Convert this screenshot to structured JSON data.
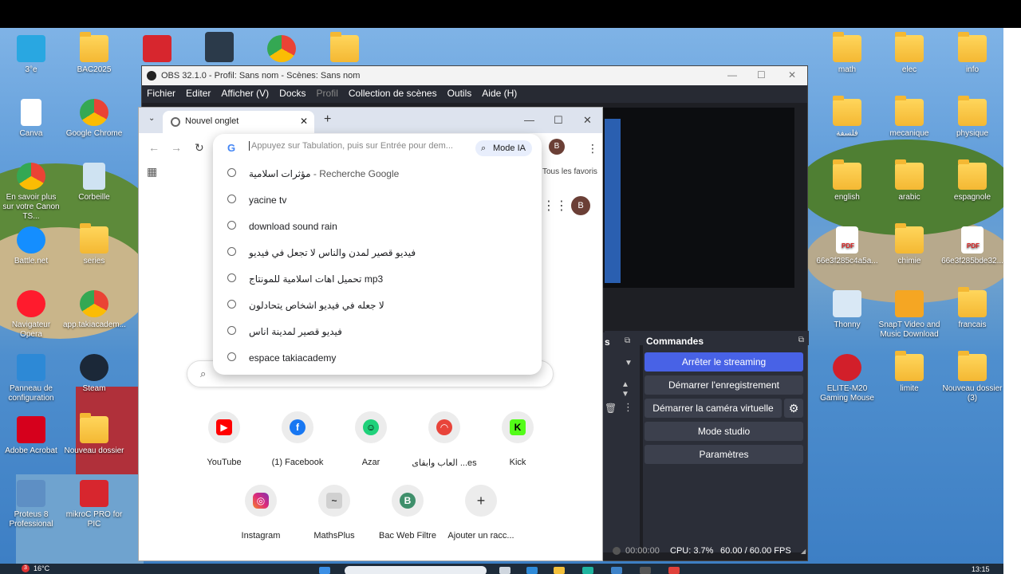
{
  "desktop": {
    "left_icons": [
      {
        "label": "3°e",
        "kind": "monitor"
      },
      {
        "label": "BAC2025",
        "kind": "folder"
      },
      {
        "label": "Canva",
        "kind": "file"
      },
      {
        "label": "Google Chrome",
        "kind": "chrome"
      },
      {
        "label": "En savoir plus sur votre Canon TS...",
        "kind": "chrome"
      },
      {
        "label": "Corbeille",
        "kind": "bin"
      },
      {
        "label": "Battle.net",
        "kind": "battlenet"
      },
      {
        "label": "series",
        "kind": "folder"
      },
      {
        "label": "Navigateur Opera",
        "kind": "opera"
      },
      {
        "label": "app.takiacadem...",
        "kind": "chrome"
      },
      {
        "label": "Panneau de configuration",
        "kind": "panel"
      },
      {
        "label": "Steam",
        "kind": "steam"
      },
      {
        "label": "Adobe Acrobat",
        "kind": "acrobat"
      },
      {
        "label": "Nouveau dossier",
        "kind": "folder"
      },
      {
        "label": "Proteus 8 Professional",
        "kind": "proteus"
      },
      {
        "label": "mikroC PRO for PIC",
        "kind": "mikroc"
      }
    ],
    "right_icons": [
      {
        "label": "math",
        "kind": "folder"
      },
      {
        "label": "elec",
        "kind": "folder"
      },
      {
        "label": "info",
        "kind": "folder"
      },
      {
        "label": "فلسفة",
        "kind": "folder"
      },
      {
        "label": "mecanique",
        "kind": "folder"
      },
      {
        "label": "physique",
        "kind": "folder"
      },
      {
        "label": "english",
        "kind": "folder"
      },
      {
        "label": "arabic",
        "kind": "folder"
      },
      {
        "label": "espagnole",
        "kind": "folder"
      },
      {
        "label": "66e3f285c4a5a...",
        "kind": "pdf"
      },
      {
        "label": "chimie",
        "kind": "folder"
      },
      {
        "label": "66e3f285bde32...",
        "kind": "pdf"
      },
      {
        "label": "Thonny",
        "kind": "thonny"
      },
      {
        "label": "SnapT Video and Music Download",
        "kind": "snap"
      },
      {
        "label": "francais",
        "kind": "folder"
      },
      {
        "label": "ELITE-M20 Gaming Mouse",
        "kind": "mouse"
      },
      {
        "label": "limite",
        "kind": "folder"
      },
      {
        "label": "Nouveau dossier (3)",
        "kind": "folder"
      }
    ]
  },
  "taskbar": {
    "weather": "16°C",
    "clock": "13:15",
    "badge": "3"
  },
  "obs": {
    "title": "OBS 32.1.0 - Profil: Sans nom - Scènes: Sans nom",
    "menu": [
      "Fichier",
      "Editer",
      "Afficher (V)",
      "Docks",
      "Profil",
      "Collection de scènes",
      "Outils",
      "Aide (H)"
    ],
    "side_label": "s",
    "commands_title": "Commandes",
    "buttons": {
      "stop_stream": "Arrêter le streaming",
      "start_record": "Démarrer l'enregistrement",
      "start_vcam": "Démarrer la caméra virtuelle",
      "studio": "Mode studio",
      "settings": "Paramètres"
    },
    "status": {
      "time": "00:00:00",
      "cpu": "CPU: 3.7%",
      "fps": "60.00 / 60.00 FPS"
    }
  },
  "chrome": {
    "tab_title": "Nouvel onglet",
    "omnibox_placeholder": "Appuyez sur Tabulation, puis sur Entrée pour dem...",
    "mode_ia": "Mode IA",
    "avatar": "B",
    "bookmarks_label": "Tous les favoris",
    "suggestions": [
      {
        "text": "مؤثرات اسلامية",
        "suffix": " - Recherche Google"
      },
      {
        "text": "yacine tv",
        "suffix": ""
      },
      {
        "text": "download sound rain",
        "suffix": ""
      },
      {
        "text": "فيديو قصير لمدن والناس لا تجعل في فيديو",
        "suffix": ""
      },
      {
        "text": "تحميل اهات اسلامية للمونتاج mp3",
        "suffix": ""
      },
      {
        "text": "لا جعله في فيديو اشخاص يتحادلون",
        "suffix": ""
      },
      {
        "text": "فيديو قصير لمدينة اناس",
        "suffix": ""
      },
      {
        "text": "espace takiacademy",
        "suffix": ""
      }
    ],
    "shortcuts": [
      {
        "label": "YouTube",
        "color": "#ff0000",
        "glyph": "▶"
      },
      {
        "label": "(1) Facebook",
        "color": "#1877f2",
        "glyph": "f"
      },
      {
        "label": "Azar",
        "color": "#1fd17a",
        "glyph": "☺"
      },
      {
        "label": "العاب وابقاى ...es",
        "color": "#e8443a",
        "glyph": "◠"
      },
      {
        "label": "Kick",
        "color": "#0a0a0a",
        "glyph": "K"
      },
      {
        "label": "Instagram",
        "color": "#d6249f",
        "glyph": "◎"
      },
      {
        "label": "MathsPlus",
        "color": "#bbbbbb",
        "glyph": "~"
      },
      {
        "label": "Bac Web Filtre",
        "color": "#3f8f6b",
        "glyph": "B"
      },
      {
        "label": "Ajouter un racc...",
        "color": "#ececec",
        "glyph": "+"
      }
    ]
  }
}
